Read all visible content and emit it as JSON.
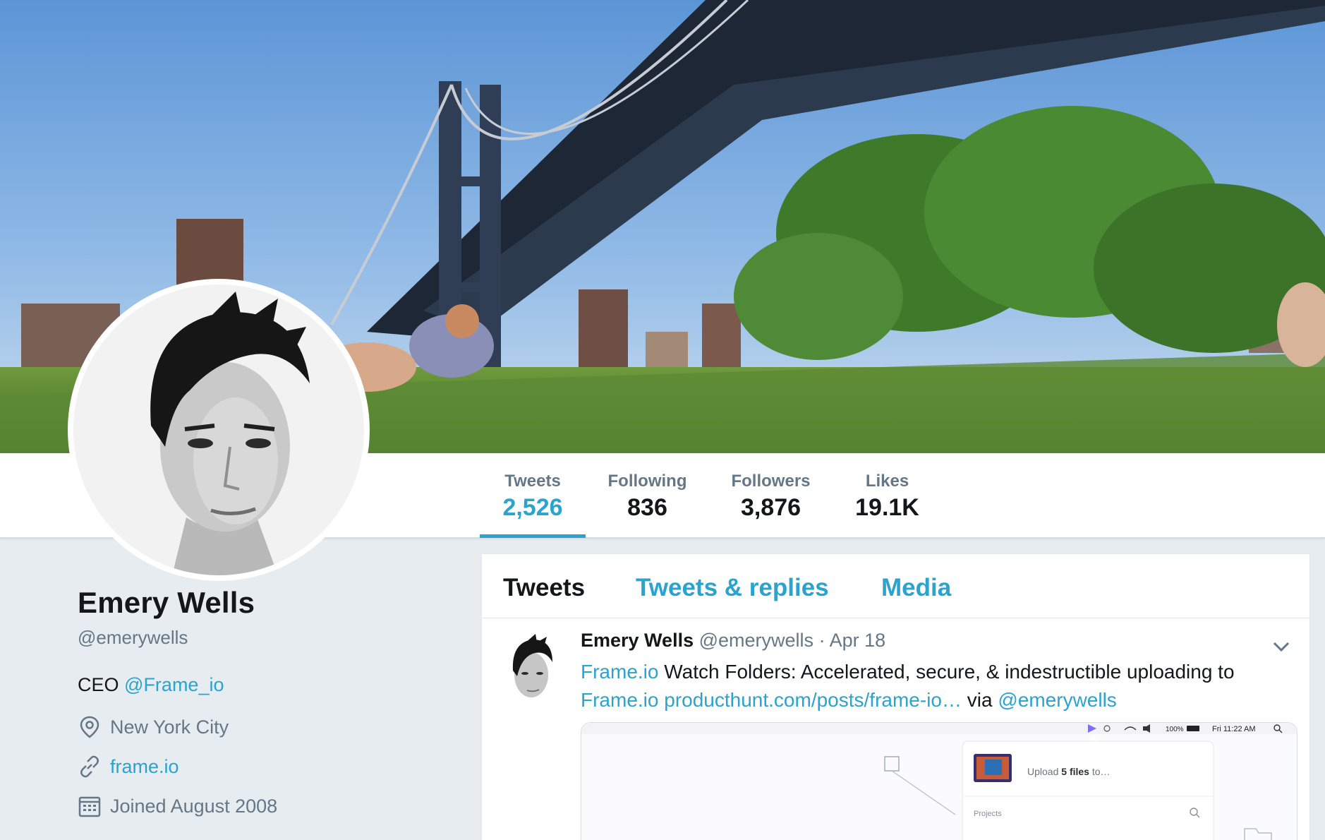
{
  "profile": {
    "name": "Emery Wells",
    "handle": "@emerywells",
    "bio_prefix": "CEO",
    "bio_link": "@Frame_io",
    "location": "New York City",
    "website": "frame.io",
    "joined": "Joined August 2008"
  },
  "stats": [
    {
      "label": "Tweets",
      "value": "2,526",
      "active": true
    },
    {
      "label": "Following",
      "value": "836",
      "active": false
    },
    {
      "label": "Followers",
      "value": "3,876",
      "active": false
    },
    {
      "label": "Likes",
      "value": "19.1K",
      "active": false
    }
  ],
  "tabs": [
    {
      "label": "Tweets",
      "active": true
    },
    {
      "label": "Tweets & replies",
      "active": false
    },
    {
      "label": "Media",
      "active": false
    }
  ],
  "tweet": {
    "name": "Emery Wells",
    "handle": "@emerywells",
    "separator": "·",
    "date": "Apr 18",
    "text_link1": "Frame.io",
    "text_body": " Watch Folders: Accelerated, secure, & indestructible uploading to ",
    "text_link2": "Frame.io",
    "text_url": "producthunt.com/posts/frame-io…",
    "text_via": " via ",
    "text_mention": "@emerywells",
    "media": {
      "menubar_battery": "100%",
      "menubar_time": "Fri 11:22 AM",
      "upload_prefix": "Upload ",
      "upload_count": "5 files",
      "upload_suffix": " to…",
      "projects_label": "Projects"
    }
  },
  "icons": {
    "location": "map-pin-icon",
    "website": "link-icon",
    "joined": "calendar-icon",
    "tweet_menu": "chevron-down-icon"
  },
  "colors": {
    "accent": "#2aa3cf",
    "text_primary": "#14171a",
    "text_secondary": "#657786",
    "page_background": "#e6ecf0"
  }
}
